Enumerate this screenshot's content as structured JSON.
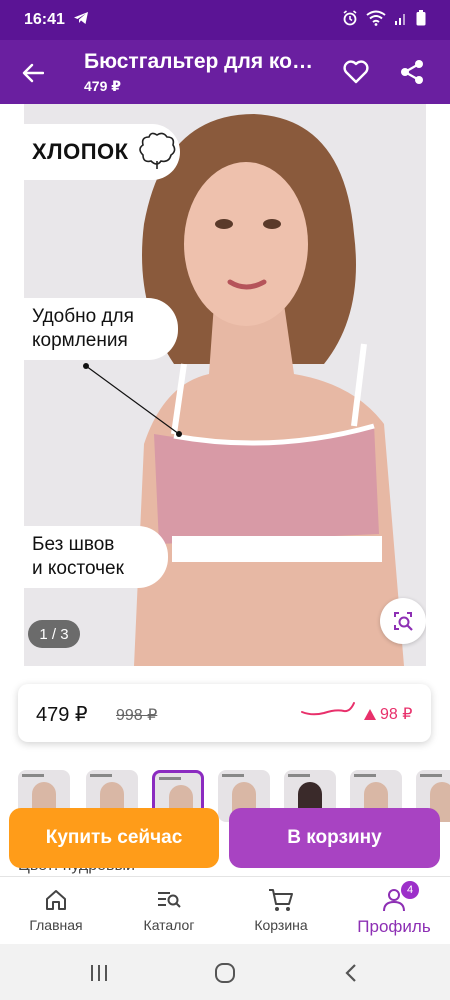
{
  "status_bar": {
    "time": "16:41",
    "icons": [
      "telegram-icon",
      "alarm-icon",
      "wifi-icon",
      "signal-icon",
      "battery-icon"
    ]
  },
  "app_bar": {
    "title": "Бюстгальтер для кормления",
    "subtitle": "479 ₽"
  },
  "product_image": {
    "labels": {
      "cotton": "ХЛОПОК",
      "feeding_line1": "Удобно для",
      "feeding_line2": "кормления",
      "seams_line1": "Без швов",
      "seams_line2": "и косточек"
    },
    "page_indicator": "1 / 3"
  },
  "price_card": {
    "current": "479 ₽",
    "old": "998 ₽",
    "change": "98 ₽",
    "change_direction": "up",
    "change_color": "#e8306b"
  },
  "thumbnails": {
    "count": 7,
    "selected_index": 2
  },
  "actions": {
    "buy_now": "Купить сейчас",
    "add_to_cart": "В корзину",
    "buy_now_color": "#ff9c19",
    "add_to_cart_color": "#a843c2"
  },
  "color_row": {
    "text": "Цвет: пудровый"
  },
  "bottom_nav": {
    "items": [
      {
        "label": "Главная",
        "icon": "home-icon"
      },
      {
        "label": "Каталог",
        "icon": "catalog-search-icon"
      },
      {
        "label": "Корзина",
        "icon": "cart-icon"
      },
      {
        "label": "Профиль",
        "icon": "profile-icon",
        "badge": "4",
        "active": true
      }
    ],
    "accent_color": "#8d2fb4"
  },
  "brand": {
    "primary": "#6a1fa0",
    "status_bar": "#5b1495"
  }
}
